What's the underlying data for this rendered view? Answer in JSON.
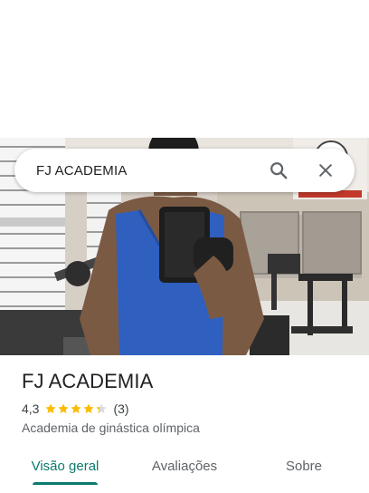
{
  "search": {
    "query": "FJ ACADEMIA",
    "search_icon": "search-icon",
    "close_icon": "close-icon"
  },
  "place": {
    "name": "FJ ACADEMIA",
    "rating": "4,3",
    "rating_value": 4.3,
    "rating_max": 5,
    "review_count": "(3)",
    "category": "Academia de ginástica olímpica"
  },
  "tabs": [
    {
      "label": "Visão geral",
      "active": true
    },
    {
      "label": "Avaliações",
      "active": false
    },
    {
      "label": "Sobre",
      "active": false
    }
  ],
  "colors": {
    "accent": "#0b7a6e",
    "star": "#fbbc04",
    "star_empty": "#dadce0",
    "muted_text": "#5f6368"
  }
}
